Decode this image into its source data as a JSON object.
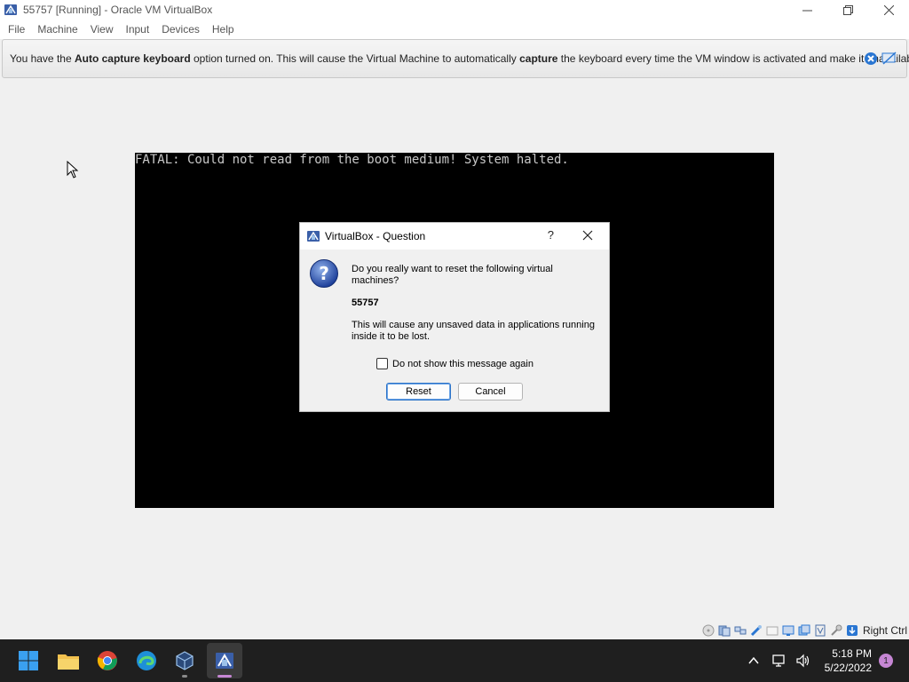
{
  "window": {
    "title": "55757 [Running] - Oracle VM VirtualBox"
  },
  "menu": {
    "items": [
      "File",
      "Machine",
      "View",
      "Input",
      "Devices",
      "Help"
    ]
  },
  "notice": {
    "part1": "You have the ",
    "bold1": "Auto capture keyboard",
    "part2": " option turned on. This will cause the Virtual Machine to automatically ",
    "bold2": "capture",
    "part3": " the keyboard every time the VM window is activated and make it unavailable to"
  },
  "vm_screen": {
    "text": "FATAL: Could not read from the boot medium! System halted."
  },
  "dialog": {
    "title": "VirtualBox - Question",
    "help": "?",
    "message": "Do you really want to reset the following virtual machines?",
    "vm_name": "55757",
    "warning": "This will cause any unsaved data in applications running inside it to be lost.",
    "checkbox_label": "Do not show this message again",
    "reset_label": "Reset",
    "cancel_label": "Cancel"
  },
  "statusbar": {
    "host_key": "Right Ctrl"
  },
  "taskbar": {
    "time": "5:18 PM",
    "date": "5/22/2022",
    "notification_count": "1"
  },
  "colors": {
    "taskbar_bg": "#1f1f1f",
    "vm_bg": "#000000",
    "accent": "#2b73c8"
  }
}
